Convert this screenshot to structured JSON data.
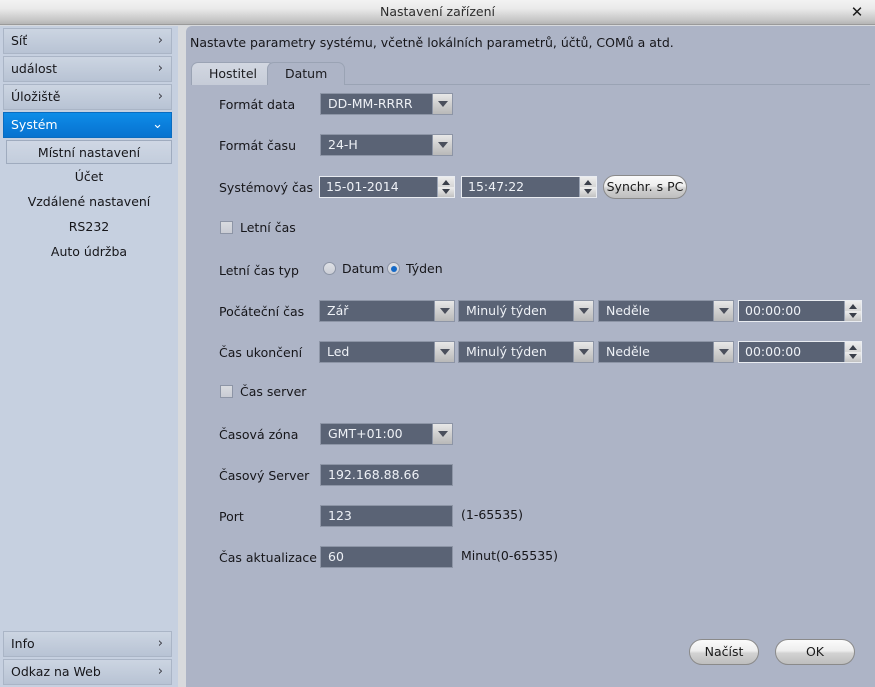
{
  "window": {
    "title": "Nastavení zařízení",
    "close_label": "✕"
  },
  "sidebar": {
    "top_items": [
      {
        "label": "Síť",
        "chevron": "›",
        "active": false
      },
      {
        "label": "událost",
        "chevron": "›",
        "active": false
      },
      {
        "label": "Úložiště",
        "chevron": "›",
        "active": false
      },
      {
        "label": "Systém",
        "chevron": "⌄",
        "active": true
      }
    ],
    "sub_items": [
      {
        "label": "Místní nastavení",
        "selected": true
      },
      {
        "label": "Účet",
        "selected": false
      },
      {
        "label": "Vzdálené nastavení",
        "selected": false
      },
      {
        "label": "RS232",
        "selected": false
      },
      {
        "label": "Auto údržba",
        "selected": false
      }
    ],
    "bottom_items": [
      {
        "label": "Info",
        "chevron": "›"
      },
      {
        "label": "Odkaz na Web",
        "chevron": "›"
      }
    ]
  },
  "panel": {
    "description": "Nastavte parametry systému, včetně lokálních parametrů, účtů, COMů a atd.",
    "tabs": [
      {
        "label": "Hostitel",
        "active": false
      },
      {
        "label": "Datum",
        "active": true
      }
    ]
  },
  "form": {
    "date_format": {
      "label": "Formát data",
      "value": "DD-MM-RRRR"
    },
    "time_format": {
      "label": "Formát času",
      "value": "24-H"
    },
    "system_time": {
      "label": "Systémový čas",
      "date_value": "15-01-2014",
      "time_value": "15:47:22",
      "sync_button": "Synchr. s  PC"
    },
    "dst_enable": {
      "label": "Letní čas",
      "checked": false
    },
    "dst_type": {
      "label": "Letní čas typ",
      "options": [
        {
          "label": "Datum",
          "checked": false
        },
        {
          "label": "Týden",
          "checked": true
        }
      ]
    },
    "start_time": {
      "label": "Počáteční čas",
      "month": "Zář",
      "week": "Minulý týden",
      "day": "Neděle",
      "time": "00:00:00"
    },
    "end_time": {
      "label": "Čas ukončení",
      "month": "Led",
      "week": "Minulý týden",
      "day": "Neděle",
      "time": "00:00:00"
    },
    "ntp_enable": {
      "label": "Čas server",
      "checked": false
    },
    "timezone": {
      "label": "Časová zóna",
      "value": "GMT+01:00"
    },
    "time_server": {
      "label": "Časový Server",
      "value": "192.168.88.66"
    },
    "port": {
      "label": "Port",
      "value": "123",
      "hint": "(1-65535)"
    },
    "update_time": {
      "label": "Čas aktualizace",
      "value": "60",
      "hint": "Minut(0-65535)"
    }
  },
  "footer": {
    "load_button": "Načíst",
    "ok_button": "OK"
  }
}
